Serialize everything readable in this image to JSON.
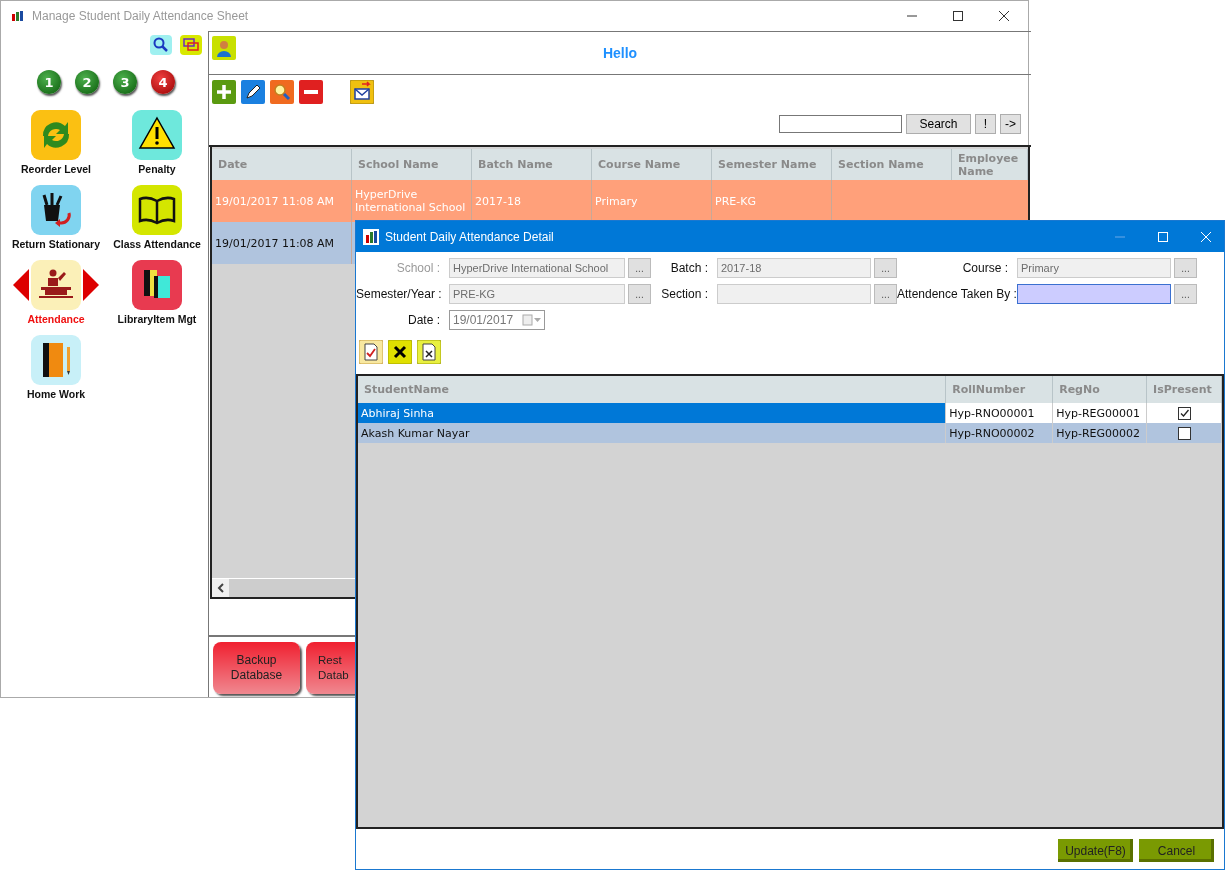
{
  "window": {
    "title": "Manage Student Daily Attendance Sheet"
  },
  "sidebar": {
    "pages": [
      {
        "label": "1",
        "selected": false
      },
      {
        "label": "2",
        "selected": false
      },
      {
        "label": "3",
        "selected": false
      },
      {
        "label": "4",
        "selected": true
      }
    ],
    "modules": [
      {
        "label": "Reorder Level",
        "kind": "reorder",
        "selected": false
      },
      {
        "label": "Penalty",
        "kind": "penalty",
        "selected": false
      },
      {
        "label": "Return Stationary",
        "kind": "stationary",
        "selected": false
      },
      {
        "label": "Class Attendance",
        "kind": "class",
        "selected": false
      },
      {
        "label": "Attendance",
        "kind": "attendance",
        "selected": true
      },
      {
        "label": "LibraryItem Mgt",
        "kind": "library",
        "selected": false
      },
      {
        "label": "Home Work",
        "kind": "homework",
        "selected": false
      }
    ]
  },
  "header": {
    "greeting": "Hello"
  },
  "search": {
    "button": "Search",
    "extra_buttons": [
      "!",
      "->"
    ]
  },
  "table": {
    "columns": [
      "Date",
      "School Name",
      "Batch Name",
      "Course Name",
      "Semester Name",
      "Section Name",
      "Employee Name"
    ],
    "rows": [
      {
        "selected": true,
        "cells": [
          "19/01/2017 11:08 AM",
          "HyperDrive International School",
          "2017-18",
          "Primary",
          "PRE-KG"
        ]
      },
      {
        "selected": false,
        "cells": [
          "19/01/2017 11:08 AM"
        ]
      }
    ]
  },
  "footer_buttons": [
    {
      "lines": [
        "Backup",
        "Database"
      ]
    },
    {
      "lines": [
        "Rest",
        "Datab"
      ]
    }
  ],
  "dialog": {
    "title": "Student Daily Attendance Detail",
    "fields": [
      {
        "label": "School :",
        "value": "HyperDrive International School",
        "button": "...",
        "kind": "lookup",
        "disabled": true,
        "focused": false
      },
      {
        "label": "Batch :",
        "value": "2017-18",
        "button": "...",
        "kind": "lookup",
        "disabled": false,
        "focused": false
      },
      {
        "label": "Course :",
        "value": "Primary",
        "button": "...",
        "kind": "lookup",
        "disabled": false,
        "focused": false
      },
      {
        "label": "Semester/Year :",
        "value": "PRE-KG",
        "button": "...",
        "kind": "lookup",
        "disabled": false,
        "focused": false
      },
      {
        "label": "Section :",
        "button": "...",
        "kind": "lookup",
        "disabled": false,
        "focused": false
      },
      {
        "label": "Attendence Taken By :",
        "button": "...",
        "kind": "lookup",
        "disabled": false,
        "focused": true
      },
      {
        "label": "Date :",
        "value": "19/01/2017",
        "kind": "date",
        "disabled": false,
        "focused": false
      }
    ],
    "grid": {
      "columns": [
        "StudentName",
        "RollNumber",
        "RegNo",
        "IsPresent"
      ],
      "rows": [
        {
          "selected": true,
          "name": "Abhiraj Sinha",
          "roll": "Hyp-RNO00001",
          "reg": "Hyp-REG00001",
          "present": true
        },
        {
          "selected": false,
          "name": "Akash Kumar Nayar",
          "roll": "Hyp-RNO00002",
          "reg": "Hyp-REG00002",
          "present": false
        }
      ]
    },
    "buttons": [
      "Update(F8)",
      "Cancel"
    ]
  }
}
